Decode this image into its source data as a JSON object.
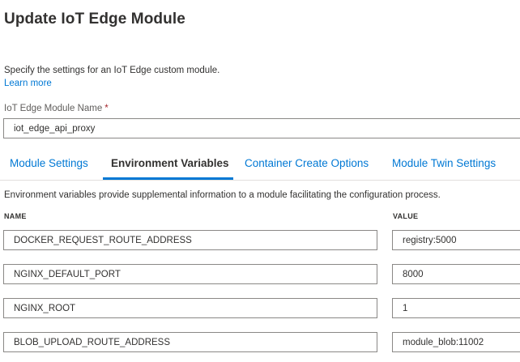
{
  "header": {
    "title": "Update IoT Edge Module"
  },
  "intro": {
    "description": "Specify the settings for an IoT Edge custom module.",
    "learn_more": "Learn more"
  },
  "module_name": {
    "label": "IoT Edge Module Name",
    "required_marker": "*",
    "value": "iot_edge_api_proxy"
  },
  "tabs": [
    {
      "label": "Module Settings",
      "active": false
    },
    {
      "label": "Environment Variables",
      "active": true
    },
    {
      "label": "Container Create Options",
      "active": false
    },
    {
      "label": "Module Twin Settings",
      "active": false
    }
  ],
  "env": {
    "description": "Environment variables provide supplemental information to a module facilitating the configuration process.",
    "columns": {
      "name": "NAME",
      "value": "VALUE"
    },
    "rows": [
      {
        "name": "DOCKER_REQUEST_ROUTE_ADDRESS",
        "value": "registry:5000"
      },
      {
        "name": "NGINX_DEFAULT_PORT",
        "value": "8000"
      },
      {
        "name": "NGINX_ROOT",
        "value": "1"
      },
      {
        "name": "BLOB_UPLOAD_ROUTE_ADDRESS",
        "value": "module_blob:11002"
      }
    ]
  },
  "colors": {
    "accent": "#0078d4",
    "text": "#323130",
    "required": "#a4262c",
    "border": "#8a8886"
  }
}
